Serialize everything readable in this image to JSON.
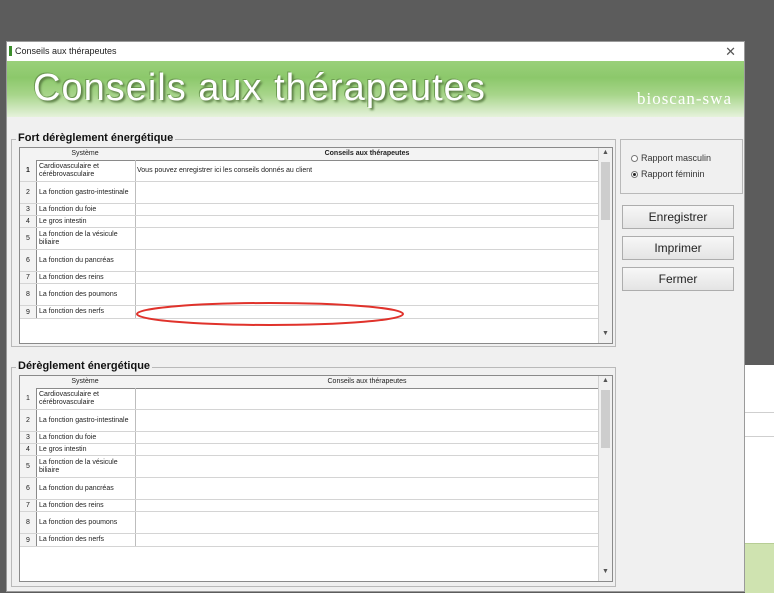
{
  "window": {
    "title": "Conseils aux thérapeutes",
    "close_glyph": "✕"
  },
  "banner": {
    "heading": "Conseils aux thérapeutes",
    "brand": "bioscan-swa"
  },
  "section1": {
    "legend": "Fort dérèglement énergétique",
    "columns": [
      "Système",
      "Conseils aux thérapeutes"
    ],
    "rows": [
      {
        "num": "1",
        "system": "Cardiovasculaire et cérébrovasculaire",
        "advice": "Vous pouvez enregistrer ici les conseils donnés au client"
      },
      {
        "num": "2",
        "system": "La fonction gastro-intestinale",
        "advice": ""
      },
      {
        "num": "3",
        "system": "La fonction du foie",
        "advice": ""
      },
      {
        "num": "4",
        "system": "Le gros intestin",
        "advice": ""
      },
      {
        "num": "5",
        "system": "La fonction de la vésicule biliaire",
        "advice": ""
      },
      {
        "num": "6",
        "system": "La fonction du pancréas",
        "advice": ""
      },
      {
        "num": "7",
        "system": "La fonction des reins",
        "advice": ""
      },
      {
        "num": "8",
        "system": "La fonction des poumons",
        "advice": ""
      },
      {
        "num": "9",
        "system": "La fonction des nerfs",
        "advice": ""
      }
    ]
  },
  "section2": {
    "legend": "Dérèglement énergétique",
    "columns": [
      "Système",
      "Conseils aux thérapeutes"
    ],
    "rows": [
      {
        "num": "1",
        "system": "Cardiovasculaire et cérébrovasculaire",
        "advice": ""
      },
      {
        "num": "2",
        "system": "La fonction gastro-intestinale",
        "advice": ""
      },
      {
        "num": "3",
        "system": "La fonction du foie",
        "advice": ""
      },
      {
        "num": "4",
        "system": "Le gros intestin",
        "advice": ""
      },
      {
        "num": "5",
        "system": "La fonction de la vésicule biliaire",
        "advice": ""
      },
      {
        "num": "6",
        "system": "La fonction du pancréas",
        "advice": ""
      },
      {
        "num": "7",
        "system": "La fonction des reins",
        "advice": ""
      },
      {
        "num": "8",
        "system": "La fonction des poumons",
        "advice": ""
      },
      {
        "num": "9",
        "system": "La fonction des nerfs",
        "advice": ""
      }
    ]
  },
  "report": {
    "options": [
      {
        "label": "Rapport masculin",
        "selected": false
      },
      {
        "label": "Rapport féminin",
        "selected": true
      }
    ]
  },
  "buttons": {
    "save": "Enregistrer",
    "print": "Imprimer",
    "close": "Fermer"
  },
  "scroll": {
    "up": "▲",
    "down": "▼"
  },
  "colors": {
    "banner": "#8cc86b",
    "annotation": "#e0322b"
  }
}
